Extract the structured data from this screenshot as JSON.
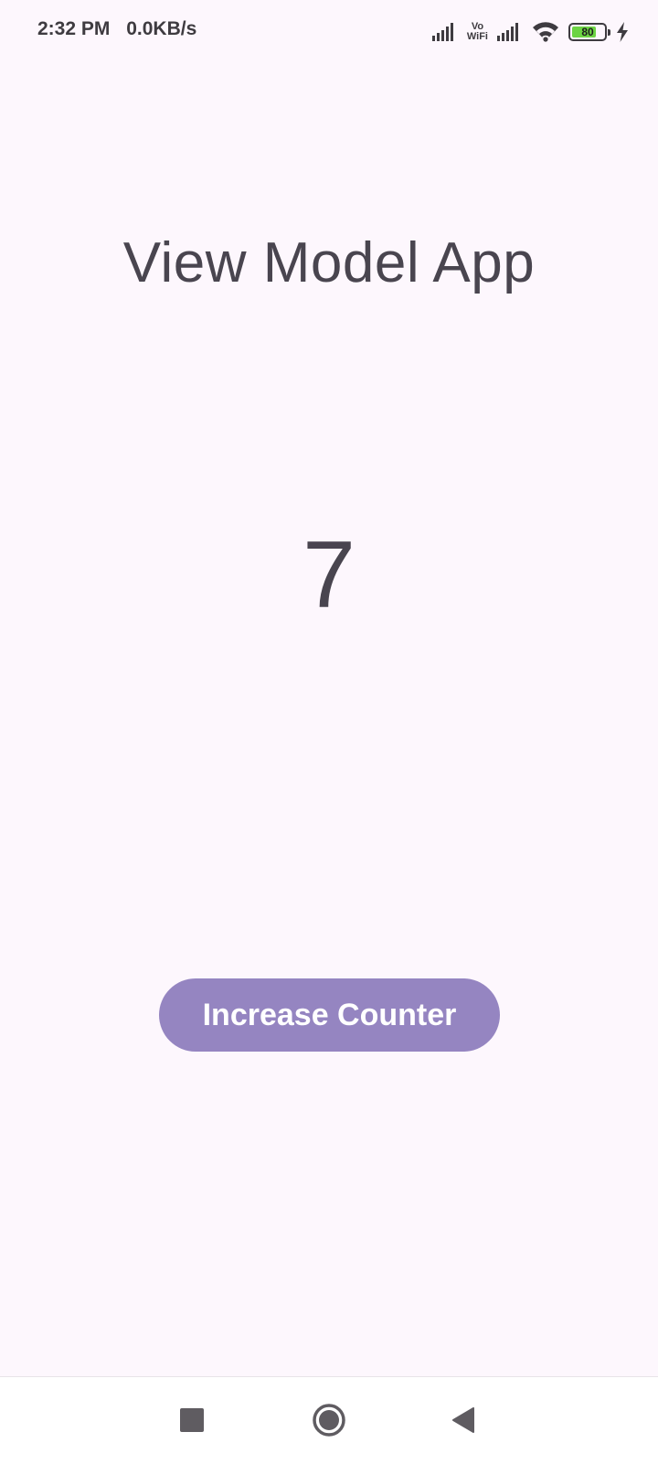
{
  "status_bar": {
    "time": "2:32 PM",
    "net_speed": "0.0KB/s",
    "vowifi_top": "Vo",
    "vowifi_bottom": "WiFi",
    "battery_level": "80",
    "icons": [
      "signal-icon",
      "vowifi-icon",
      "signal-icon",
      "wifi-icon",
      "battery-icon",
      "charging-icon"
    ]
  },
  "app": {
    "title": "View Model App",
    "counter": "7",
    "increase_button_label": "Increase Counter",
    "button_color": "#9585c1",
    "background_color": "#fdf7fd"
  },
  "nav_bar": {
    "icons": [
      "recents-icon",
      "home-icon",
      "back-icon"
    ]
  }
}
